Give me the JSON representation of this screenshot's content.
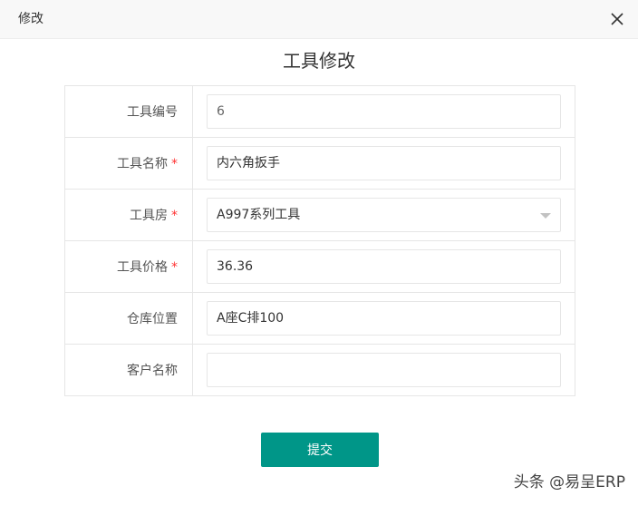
{
  "dialog": {
    "title": "修改",
    "close_icon": "close-icon"
  },
  "form": {
    "title": "工具修改",
    "required_mark": "*",
    "fields": [
      {
        "label": "工具编号",
        "required": false,
        "value": "6",
        "type": "text",
        "readonly": true
      },
      {
        "label": "工具名称",
        "required": true,
        "value": "内六角扳手",
        "type": "text"
      },
      {
        "label": "工具房",
        "required": true,
        "value": "A997系列工具",
        "type": "select"
      },
      {
        "label": "工具价格",
        "required": true,
        "value": "36.36",
        "type": "text"
      },
      {
        "label": "仓库位置",
        "required": false,
        "value": "A座C排100",
        "type": "text"
      },
      {
        "label": "客户名称",
        "required": false,
        "value": "",
        "type": "text"
      }
    ],
    "submit_label": "提交"
  },
  "watermark": "头条 @易呈ERP",
  "colors": {
    "primary": "#009688",
    "required": "#ff3333",
    "border": "#e6e6e6",
    "header_bg": "#f8f8f8"
  }
}
